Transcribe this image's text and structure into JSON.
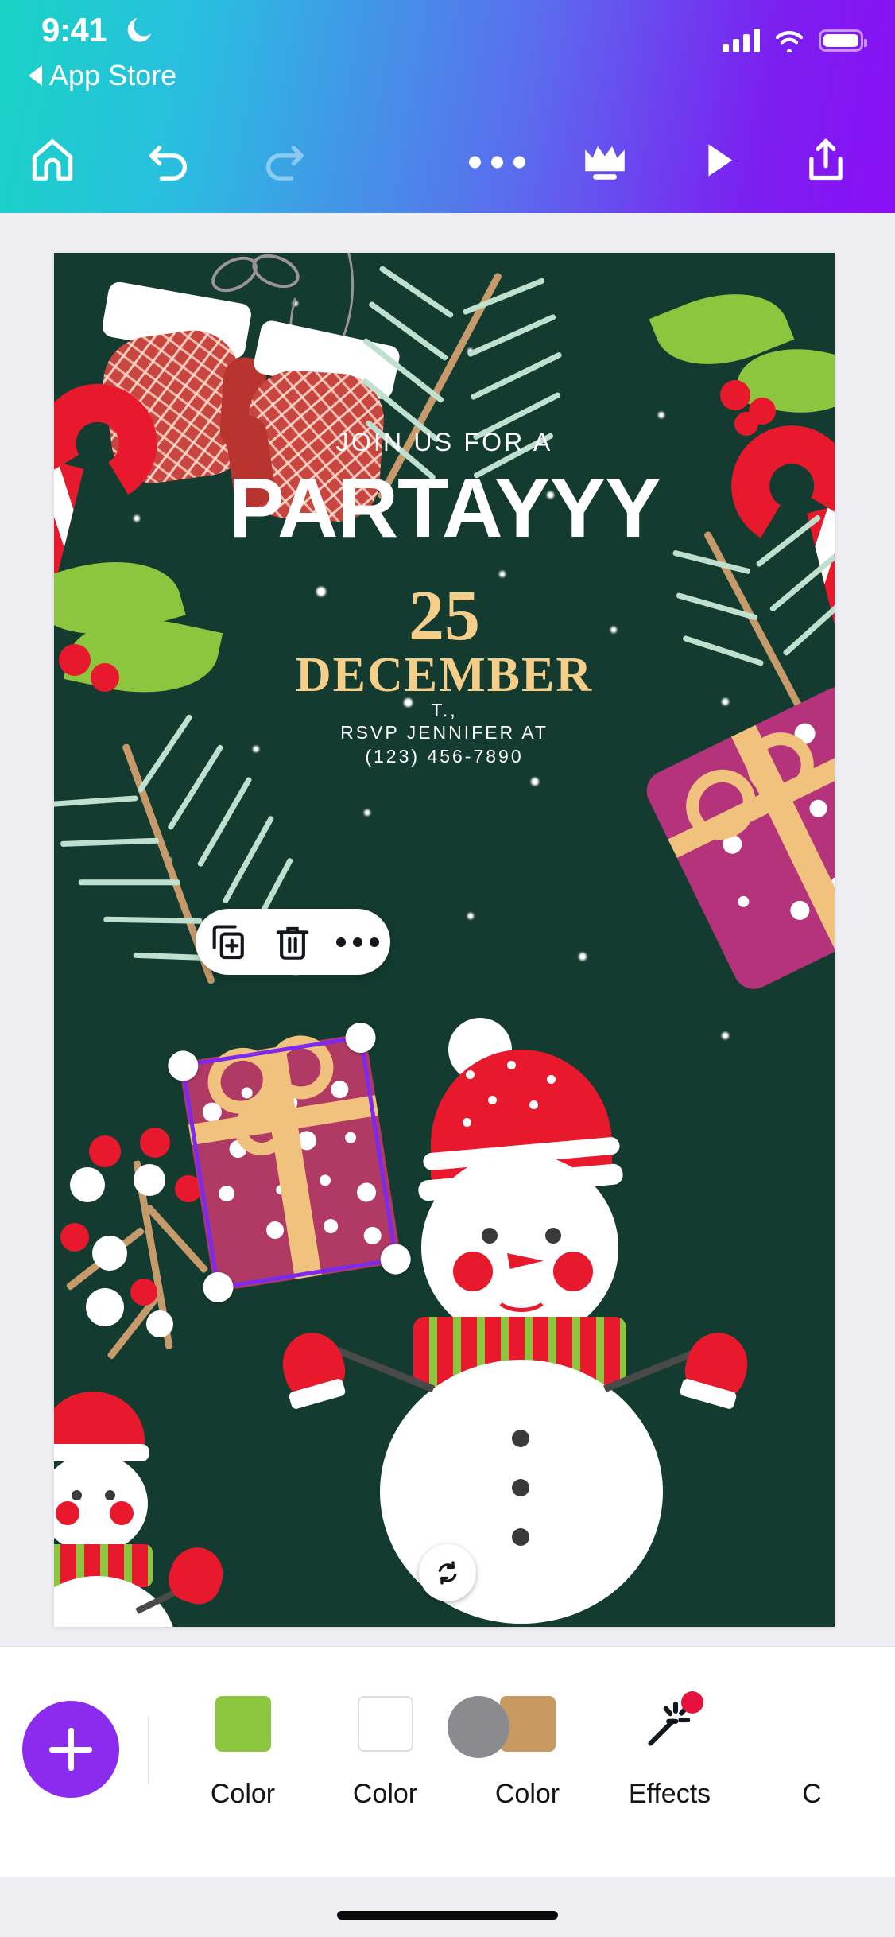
{
  "status_bar": {
    "time": "9:41",
    "dnd_icon": "moon-icon",
    "back_label": "App Store",
    "back_icon": "back-triangle-icon",
    "signal_icon": "cellular-bars-icon",
    "wifi_icon": "wifi-icon",
    "battery_icon": "battery-icon"
  },
  "toolbar": {
    "home_icon": "home-icon",
    "undo_icon": "undo-icon",
    "redo_icon": "redo-icon",
    "more_icon": "more-horizontal-icon",
    "crown_icon": "crown-icon",
    "play_icon": "play-icon",
    "share_icon": "share-upload-icon"
  },
  "canvas": {
    "background_color": "#143B30",
    "invite": {
      "eyebrow": "JOIN US FOR A",
      "title": "PARTAYYY",
      "day": "25",
      "month": "DECEMBER",
      "address_partial": "T.,",
      "rsvp_line": "RSVP JENNIFER AT",
      "phone": "(123) 456-7890"
    },
    "accent_gold": "#F5CE8A",
    "accent_red": "#E8192C",
    "accent_green": "#8CC63F",
    "gift_color": "#B03A63"
  },
  "selection": {
    "element": "gift-box",
    "border_color": "#7B2AEE",
    "rotate_icon": "rotate-icon",
    "handle_count": 4
  },
  "context_menu": {
    "duplicate_icon": "duplicate-icon",
    "delete_icon": "trash-icon",
    "more_icon": "more-horizontal-icon"
  },
  "bottom_bar": {
    "add_label": "+",
    "add_icon": "plus-icon",
    "items": [
      {
        "label": "Color",
        "swatch": "#8CC63F",
        "type": "swatch"
      },
      {
        "label": "Color",
        "swatch": "#FFFFFF",
        "type": "swatch-bordered"
      },
      {
        "label": "Color",
        "swatch": "#C89A62",
        "type": "swatch"
      },
      {
        "label": "Effects",
        "icon": "magic-wand-icon",
        "badge": "#E6113C"
      },
      {
        "label": "C",
        "type": "clipped"
      }
    ]
  }
}
